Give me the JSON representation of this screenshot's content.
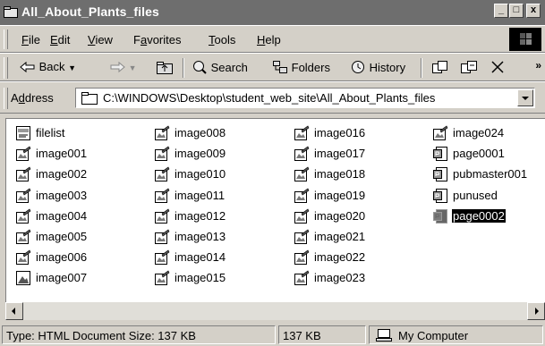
{
  "window": {
    "title": "All_About_Plants_files"
  },
  "title_buttons": {
    "minimize": "_",
    "maximize": "□",
    "close": "x"
  },
  "menu": {
    "items": [
      "File",
      "Edit",
      "View",
      "Favorites",
      "Tools",
      "Help"
    ]
  },
  "toolbar": {
    "back": "Back",
    "search": "Search",
    "folders": "Folders",
    "history": "History",
    "more": "»"
  },
  "address": {
    "label": "Address",
    "value": "C:\\WINDOWS\\Desktop\\student_web_site\\All_About_Plants_files"
  },
  "files": [
    {
      "name": "filelist",
      "icon": "xml-file-icon"
    },
    {
      "name": "image001",
      "icon": "image-file-icon"
    },
    {
      "name": "image002",
      "icon": "image-file-icon"
    },
    {
      "name": "image003",
      "icon": "image-file-icon"
    },
    {
      "name": "image004",
      "icon": "image-file-icon"
    },
    {
      "name": "image005",
      "icon": "image-file-icon"
    },
    {
      "name": "image006",
      "icon": "image-file-icon"
    },
    {
      "name": "image007",
      "icon": "picture-file-icon"
    },
    {
      "name": "image008",
      "icon": "image-file-icon"
    },
    {
      "name": "image009",
      "icon": "image-file-icon"
    },
    {
      "name": "image010",
      "icon": "image-file-icon"
    },
    {
      "name": "image011",
      "icon": "image-file-icon"
    },
    {
      "name": "image012",
      "icon": "image-file-icon"
    },
    {
      "name": "image013",
      "icon": "image-file-icon"
    },
    {
      "name": "image014",
      "icon": "image-file-icon"
    },
    {
      "name": "image015",
      "icon": "image-file-icon"
    },
    {
      "name": "image016",
      "icon": "image-file-icon"
    },
    {
      "name": "image017",
      "icon": "image-file-icon"
    },
    {
      "name": "image018",
      "icon": "image-file-icon"
    },
    {
      "name": "image019",
      "icon": "image-file-icon"
    },
    {
      "name": "image020",
      "icon": "image-file-icon"
    },
    {
      "name": "image021",
      "icon": "image-file-icon"
    },
    {
      "name": "image022",
      "icon": "image-file-icon"
    },
    {
      "name": "image023",
      "icon": "image-file-icon"
    },
    {
      "name": "image024",
      "icon": "image-file-icon"
    },
    {
      "name": "page0001",
      "icon": "publisher-file-icon"
    },
    {
      "name": "pubmaster001",
      "icon": "publisher-file-icon"
    },
    {
      "name": "punused",
      "icon": "publisher-file-icon"
    },
    {
      "name": "page0002",
      "icon": "publisher-file-icon",
      "selected": true
    }
  ],
  "status": {
    "type_size": "Type: HTML Document Size: 137 KB",
    "size": "137 KB",
    "zone": "My Computer"
  },
  "colors": {
    "titlebar": "#6e6e6e",
    "face": "#d4d0c8",
    "selection": "#000000"
  }
}
